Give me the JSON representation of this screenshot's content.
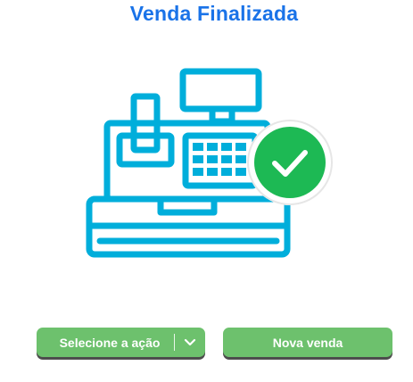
{
  "header": {
    "title": "Venda Finalizada"
  },
  "illustration": {
    "icon": "cash-register-icon",
    "badge_icon": "check-circle-icon",
    "outline_color": "#00aedb",
    "badge_color": "#1db954"
  },
  "actions": {
    "select_label": "Selecione a ação",
    "new_sale_label": "Nova venda"
  },
  "colors": {
    "title": "#1a73e8",
    "button": "#6dc16d"
  }
}
